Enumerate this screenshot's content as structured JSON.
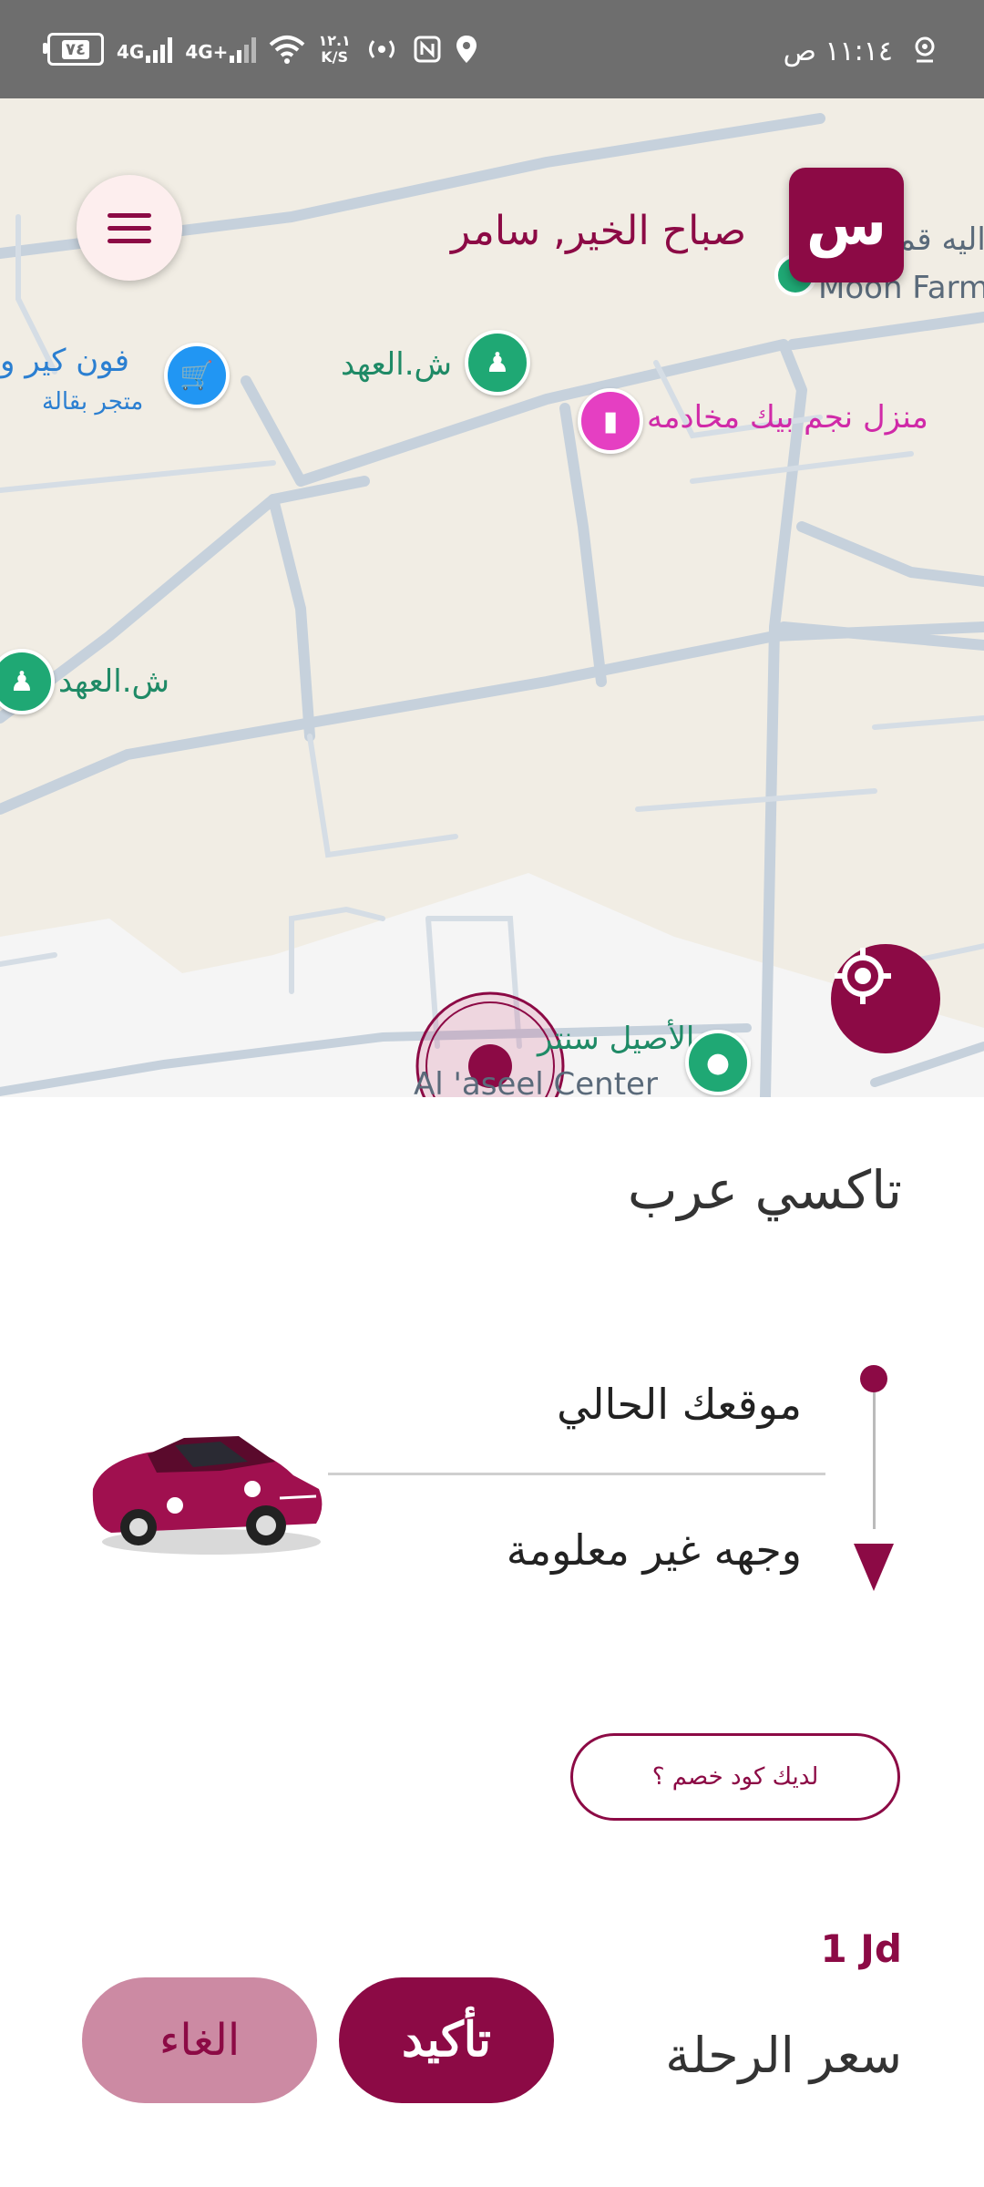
{
  "status_bar": {
    "battery": "٧٤",
    "network1": "4G",
    "network2": "4G+",
    "speed_value": "١٢.١",
    "speed_unit": "K/S",
    "time": "١١:١٤ ص"
  },
  "map": {
    "greeting": "صباح الخير, سامر",
    "avatar_initial": "س",
    "labels": {
      "moon_farm_ar": "اليه قمر",
      "moon_farm_en": "Moon Farm",
      "shop_name": "فون كير و",
      "shop_type": "متجر بقالة",
      "street1": "ش.العهد",
      "street2": "ش.العهد",
      "house": "منزل نجم بيك مخادمه",
      "center_ar": "الأصيل سنتر",
      "center_en": "Al 'aseel Center"
    }
  },
  "sheet": {
    "title": "تاكسي عرب",
    "from_label": "موقعك الحالي",
    "to_label": "وجهه غير معلومة",
    "promo_button": "لديك كود خصم ؟",
    "price_value": "1 Jd",
    "price_label": "سعر الرحلة",
    "confirm_button": "تأكيد",
    "cancel_button": "الغاء"
  },
  "colors": {
    "brand": "#8c0a45",
    "brand_light": "#cc8aa3",
    "map_bg": "#f1ede4",
    "road": "#c6d1dc"
  }
}
